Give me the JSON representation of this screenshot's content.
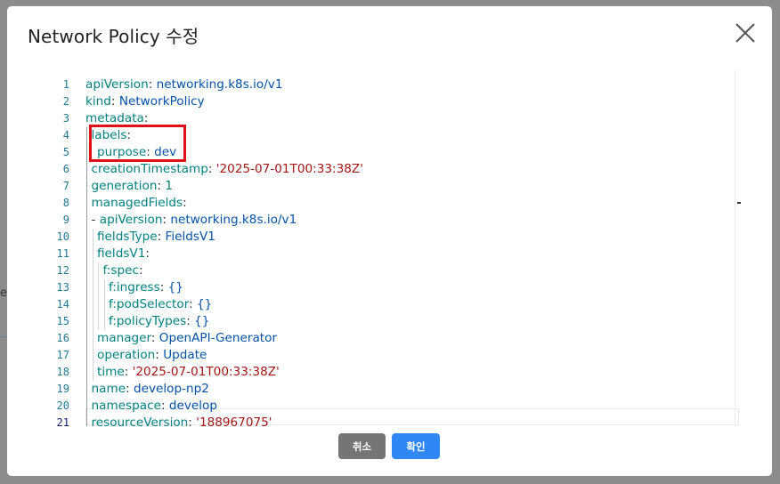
{
  "modal": {
    "title": "Network Policy 수정",
    "cancel_label": "취소",
    "confirm_label": "확인"
  },
  "editor": {
    "active_line": 21,
    "lines": [
      {
        "n": "1",
        "indent": 0,
        "parts": [
          [
            "key",
            "apiVersion"
          ],
          [
            "punct",
            ": "
          ],
          [
            "val",
            "networking.k8s.io/v1"
          ]
        ]
      },
      {
        "n": "2",
        "indent": 0,
        "parts": [
          [
            "key",
            "kind"
          ],
          [
            "punct",
            ": "
          ],
          [
            "val",
            "NetworkPolicy"
          ]
        ]
      },
      {
        "n": "3",
        "indent": 0,
        "parts": [
          [
            "key",
            "metadata"
          ],
          [
            "punct",
            ":"
          ]
        ]
      },
      {
        "n": "4",
        "indent": 1,
        "parts": [
          [
            "key",
            "labels"
          ],
          [
            "punct",
            ":"
          ]
        ]
      },
      {
        "n": "5",
        "indent": 2,
        "parts": [
          [
            "key",
            "purpose"
          ],
          [
            "punct",
            ": "
          ],
          [
            "val",
            "dev"
          ]
        ]
      },
      {
        "n": "6",
        "indent": 1,
        "parts": [
          [
            "key",
            "creationTimestamp"
          ],
          [
            "punct",
            ": "
          ],
          [
            "str",
            "'2025-07-01T00:33:38Z'"
          ]
        ]
      },
      {
        "n": "7",
        "indent": 1,
        "parts": [
          [
            "key",
            "generation"
          ],
          [
            "punct",
            ": "
          ],
          [
            "num",
            "1"
          ]
        ]
      },
      {
        "n": "8",
        "indent": 1,
        "parts": [
          [
            "key",
            "managedFields"
          ],
          [
            "punct",
            ":"
          ]
        ]
      },
      {
        "n": "9",
        "indent": 1,
        "parts": [
          [
            "punct",
            "- "
          ],
          [
            "key",
            "apiVersion"
          ],
          [
            "punct",
            ": "
          ],
          [
            "val",
            "networking.k8s.io/v1"
          ]
        ]
      },
      {
        "n": "10",
        "indent": 2,
        "parts": [
          [
            "key",
            "fieldsType"
          ],
          [
            "punct",
            ": "
          ],
          [
            "val",
            "FieldsV1"
          ]
        ]
      },
      {
        "n": "11",
        "indent": 2,
        "parts": [
          [
            "key",
            "fieldsV1"
          ],
          [
            "punct",
            ":"
          ]
        ]
      },
      {
        "n": "12",
        "indent": 3,
        "parts": [
          [
            "key",
            "f:spec"
          ],
          [
            "punct",
            ":"
          ]
        ]
      },
      {
        "n": "13",
        "indent": 4,
        "parts": [
          [
            "key",
            "f:ingress"
          ],
          [
            "punct",
            ": "
          ],
          [
            "val",
            "{}"
          ]
        ]
      },
      {
        "n": "14",
        "indent": 4,
        "parts": [
          [
            "key",
            "f:podSelector"
          ],
          [
            "punct",
            ": "
          ],
          [
            "val",
            "{}"
          ]
        ]
      },
      {
        "n": "15",
        "indent": 4,
        "parts": [
          [
            "key",
            "f:policyTypes"
          ],
          [
            "punct",
            ": "
          ],
          [
            "val",
            "{}"
          ]
        ]
      },
      {
        "n": "16",
        "indent": 2,
        "parts": [
          [
            "key",
            "manager"
          ],
          [
            "punct",
            ": "
          ],
          [
            "val",
            "OpenAPI-Generator"
          ]
        ]
      },
      {
        "n": "17",
        "indent": 2,
        "parts": [
          [
            "key",
            "operation"
          ],
          [
            "punct",
            ": "
          ],
          [
            "val",
            "Update"
          ]
        ]
      },
      {
        "n": "18",
        "indent": 2,
        "parts": [
          [
            "key",
            "time"
          ],
          [
            "punct",
            ": "
          ],
          [
            "str",
            "'2025-07-01T00:33:38Z'"
          ]
        ]
      },
      {
        "n": "19",
        "indent": 1,
        "parts": [
          [
            "key",
            "name"
          ],
          [
            "punct",
            ": "
          ],
          [
            "val",
            "develop-np2"
          ]
        ]
      },
      {
        "n": "20",
        "indent": 1,
        "parts": [
          [
            "key",
            "namespace"
          ],
          [
            "punct",
            ": "
          ],
          [
            "val",
            "develop"
          ]
        ]
      },
      {
        "n": "21",
        "indent": 1,
        "parts": [
          [
            "key",
            "resourceVersion"
          ],
          [
            "punct",
            ": "
          ],
          [
            "str",
            "'188967075'"
          ]
        ]
      }
    ]
  },
  "colors": {
    "key": "#008080",
    "string": "#a31515",
    "number": "#098658",
    "value": "#0451a5",
    "highlight": "#e0101a",
    "confirm": "#2f86f5",
    "cancel": "#757575"
  }
}
